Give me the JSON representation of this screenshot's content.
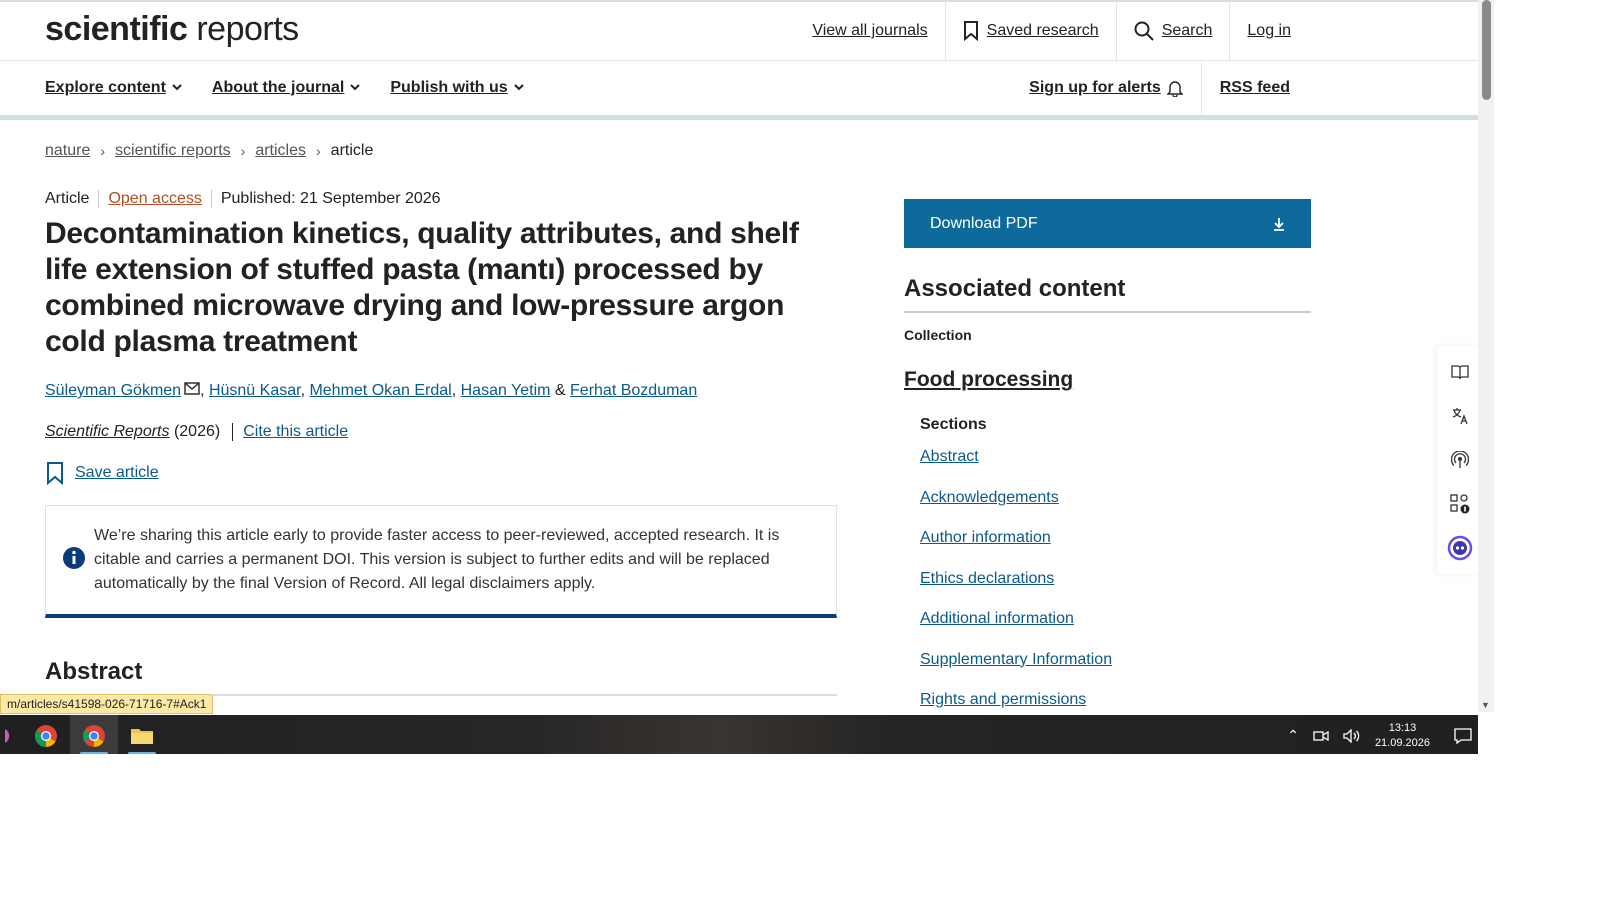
{
  "header": {
    "logo_bold": "scientific",
    "logo_light": "reports",
    "view_all": "View all journals",
    "saved": "Saved research",
    "search": "Search",
    "login": "Log in"
  },
  "nav": {
    "explore": "Explore content",
    "about": "About the journal",
    "publish": "Publish with us",
    "alerts": "Sign up for alerts",
    "rss": "RSS feed"
  },
  "breadcrumb": [
    "nature",
    "scientific reports",
    "articles",
    "article"
  ],
  "article": {
    "type": "Article",
    "open_access": "Open access",
    "published": "Published: 21 September 2026",
    "title": "Decontamination kinetics, quality attributes, and shelf life extension of stuffed pasta (mantı) processed by combined microwave drying and low-pressure argon cold plasma treatment",
    "authors": [
      "Süleyman Gökmen",
      "Hüsnü Kasar",
      "Mehmet Okan Erdal",
      "Hasan Yetim",
      "Ferhat Bozduman"
    ],
    "journal": "Scientific Reports",
    "year": "(2026)",
    "cite": "Cite this article",
    "save": "Save article",
    "notice": "We’re sharing this article early to provide faster access to peer-reviewed, accepted research. It is citable and carries a permanent DOI. This version is subject to further edits and will be replaced automatically by the final Version of Record. All legal disclaimers apply.",
    "abstract_heading": "Abstract"
  },
  "sidebar": {
    "download": "Download PDF",
    "associated": "Associated content",
    "collection": "Collection",
    "food": "Food processing",
    "sections_heading": "Sections",
    "sections": [
      "Abstract",
      "Acknowledgements",
      "Author information",
      "Ethics declarations",
      "Additional information",
      "Supplementary Information",
      "Rights and permissions"
    ]
  },
  "status_url": "m/articles/s41598-026-71716-7#Ack1",
  "taskbar": {
    "time": "13:13",
    "date": "21.09.2026"
  },
  "colors": {
    "download_bg": "#0f6a9c",
    "link": "#0b5a8c",
    "open_access": "#b04f25",
    "notice_border": "#0b3b7a"
  }
}
